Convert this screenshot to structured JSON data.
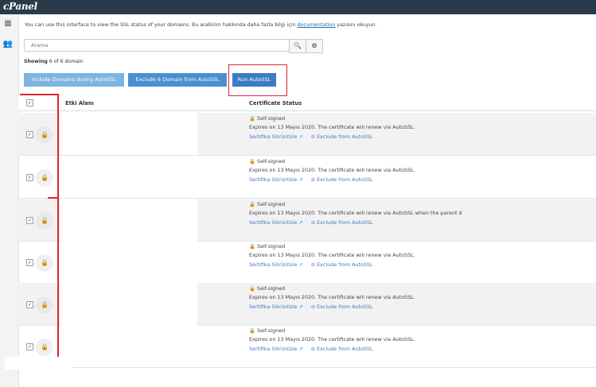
{
  "brand": {
    "logo": "cPanel"
  },
  "rail": {
    "icons": [
      "apps-grid-icon",
      "users-icon"
    ]
  },
  "intro": {
    "text": "You can use this interface to view the SSL status of your domains. Bu arabirim hakkında daha fazla bilgi için",
    "link": "documentation",
    "suffix": "yazısını okuyun."
  },
  "search": {
    "placeholder": "Arama"
  },
  "showing": {
    "label": "Showing",
    "value": "6 of 6 domain"
  },
  "actions": {
    "include": "Include Domains during AutoSSL",
    "exclude": "Exclude 6 Domain from AutoSSL",
    "run": "Run AutoSSL"
  },
  "table": {
    "headers": {
      "domain": "Etki Alanı",
      "status": "Certificate Status"
    },
    "rows": [
      {
        "status": "Self-signed",
        "detail": "Expires on 13 Mayıs 2020. The certificate will renew via AutoSSL.",
        "view": "Sertifika Görüntüle",
        "exclude": "Exclude from AutoSSL"
      },
      {
        "status": "Self-signed",
        "detail": "Expires on 13 Mayıs 2020. The certificate will renew via AutoSSL.",
        "view": "Sertifika Görüntüle",
        "exclude": "Exclude from AutoSSL"
      },
      {
        "status": "Self-signed",
        "detail": "Expires on 13 Mayıs 2020. The certificate will renew via AutoSSL when the parent d",
        "view": "Sertifika Görüntüle",
        "exclude": "Exclude from AutoSSL"
      },
      {
        "status": "Self-signed",
        "detail": "Expires on 13 Mayıs 2020. The certificate will renew via AutoSSL.",
        "view": "Sertifika Görüntüle",
        "exclude": "Exclude from AutoSSL"
      },
      {
        "status": "Self-signed",
        "detail": "Expires on 13 Mayıs 2020. The certificate will renew via AutoSSL.",
        "view": "Sertifika Görüntüle",
        "exclude": "Exclude from AutoSSL"
      },
      {
        "status": "Self-signed",
        "detail": "Expires on 13 Mayıs 2020. The certificate will renew via AutoSSL.",
        "view": "Sertifika Görüntüle",
        "exclude": "Exclude from AutoSSL"
      }
    ]
  },
  "colors": {
    "accent": "#3b7cc4",
    "highlight": "#e0262a",
    "topbar": "#293a4a"
  }
}
